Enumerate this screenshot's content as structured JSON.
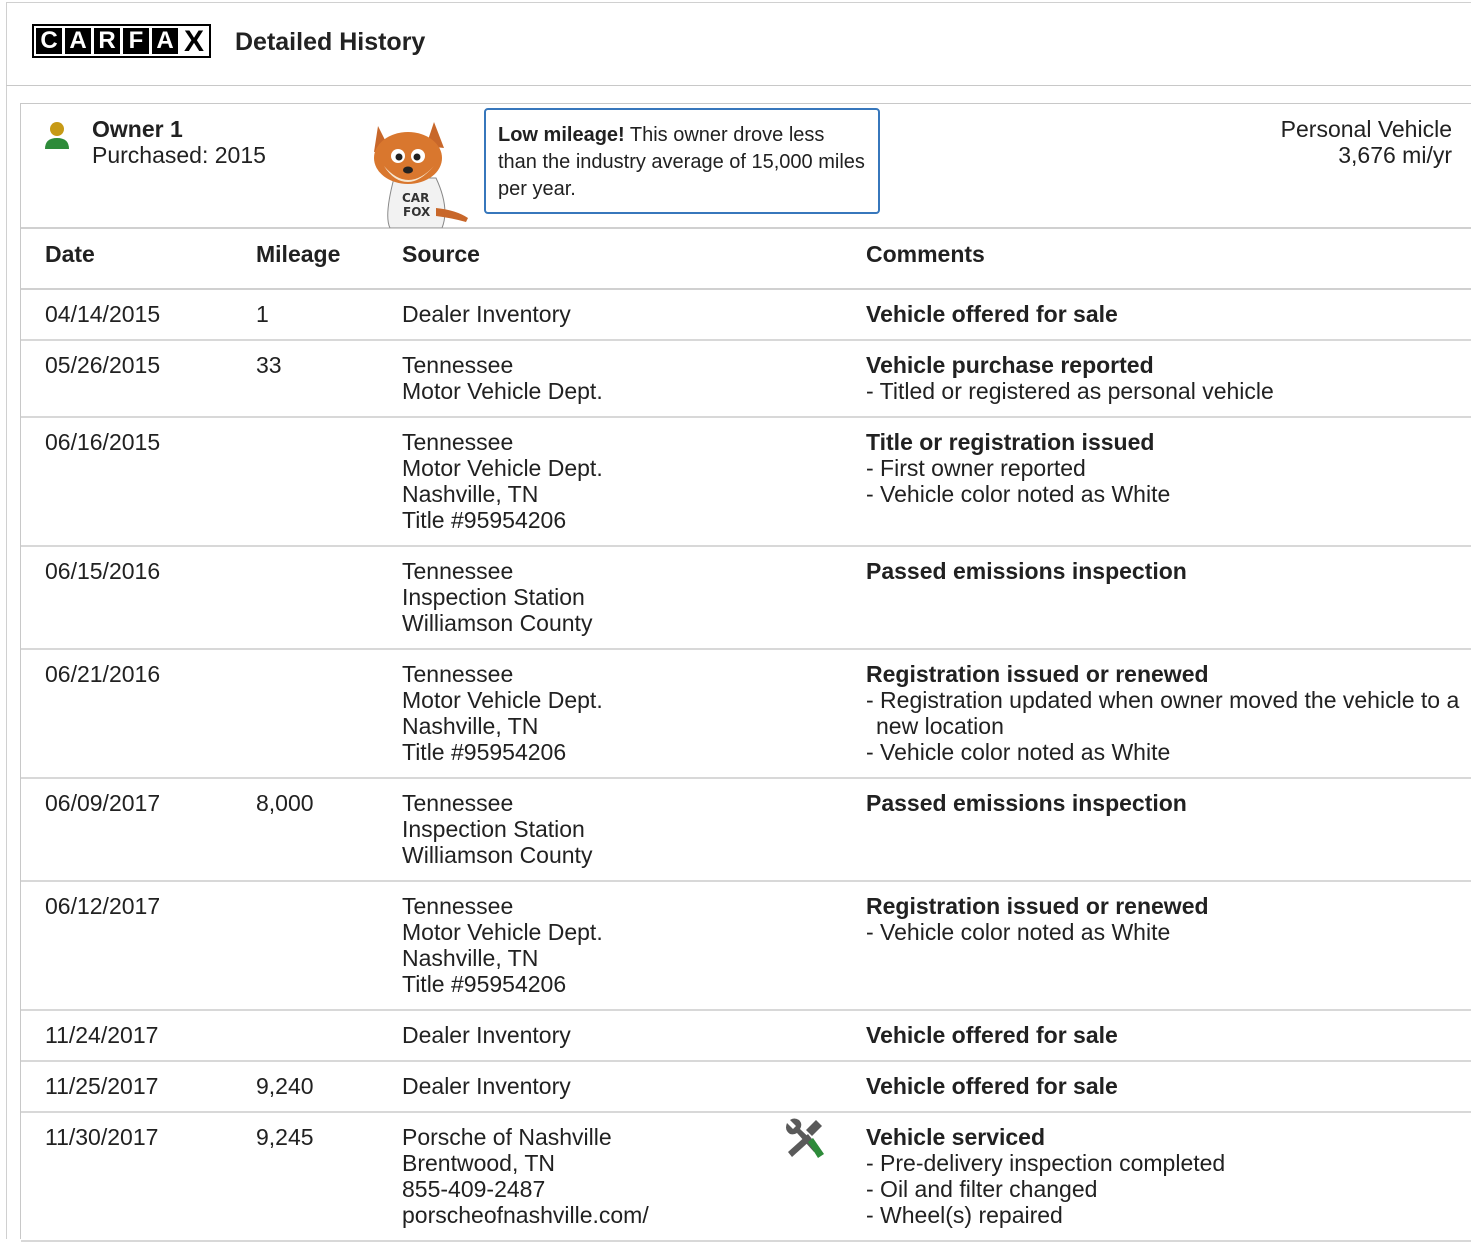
{
  "header": {
    "logo_letters": [
      "C",
      "A",
      "R",
      "F",
      "A",
      "X"
    ],
    "title": "Detailed History"
  },
  "owner": {
    "name": "Owner 1",
    "purchased": "Purchased: 2015",
    "callout_bold": "Low mileage!",
    "callout_text": " This owner drove less than the industry average of 15,000 miles per year.",
    "usage_type": "Personal Vehicle",
    "usage_rate": "3,676 mi/yr",
    "mascot_shirt": "CAR FOX"
  },
  "table": {
    "headers": {
      "date": "Date",
      "mileage": "Mileage",
      "source": "Source",
      "comments": "Comments"
    },
    "rows": [
      {
        "date": "04/14/2015",
        "mileage": "1",
        "source": [
          "Dealer Inventory"
        ],
        "title": "Vehicle offered for sale",
        "details": []
      },
      {
        "date": "05/26/2015",
        "mileage": "33",
        "source": [
          "Tennessee",
          "Motor Vehicle Dept."
        ],
        "title": "Vehicle purchase reported",
        "details": [
          "- Titled or registered as personal vehicle"
        ]
      },
      {
        "date": "06/16/2015",
        "mileage": "",
        "source": [
          "Tennessee",
          "Motor Vehicle Dept.",
          "Nashville, TN",
          "Title #95954206"
        ],
        "title": "Title or registration issued",
        "details": [
          "- First owner reported",
          "- Vehicle color noted as White"
        ]
      },
      {
        "date": "06/15/2016",
        "mileage": "",
        "source": [
          "Tennessee",
          "Inspection Station",
          "Williamson County"
        ],
        "title": "Passed emissions inspection",
        "details": []
      },
      {
        "date": "06/21/2016",
        "mileage": "",
        "source": [
          "Tennessee",
          "Motor Vehicle Dept.",
          "Nashville, TN",
          "Title #95954206"
        ],
        "title": "Registration issued or renewed",
        "details": [
          "- Registration updated when owner moved the vehicle to a new location",
          "- Vehicle color noted as White"
        ]
      },
      {
        "date": "06/09/2017",
        "mileage": "8,000",
        "source": [
          "Tennessee",
          "Inspection Station",
          "Williamson County"
        ],
        "title": "Passed emissions inspection",
        "details": []
      },
      {
        "date": "06/12/2017",
        "mileage": "",
        "source": [
          "Tennessee",
          "Motor Vehicle Dept.",
          "Nashville, TN",
          "Title #95954206"
        ],
        "title": "Registration issued or renewed",
        "details": [
          "- Vehicle color noted as White"
        ]
      },
      {
        "date": "11/24/2017",
        "mileage": "",
        "source": [
          "Dealer Inventory"
        ],
        "title": "Vehicle offered for sale",
        "details": []
      },
      {
        "date": "11/25/2017",
        "mileage": "9,240",
        "source": [
          "Dealer Inventory"
        ],
        "title": "Vehicle offered for sale",
        "details": []
      },
      {
        "date": "11/30/2017",
        "mileage": "9,245",
        "source": [
          "Porsche of Nashville",
          "Brentwood, TN",
          "855-409-2487",
          "porscheofnashville.com/"
        ],
        "icon": "service-tools-icon",
        "title": "Vehicle serviced",
        "details": [
          "- Pre-delivery inspection completed",
          "- Oil and filter changed",
          "- Wheel(s) repaired"
        ]
      }
    ]
  },
  "colors": {
    "person_head": "#c79a16",
    "person_body": "#2e8b3a",
    "callout_border": "#3777bc",
    "tool_handle": "#2e8b3a",
    "tool_metal": "#5a5a5a"
  }
}
